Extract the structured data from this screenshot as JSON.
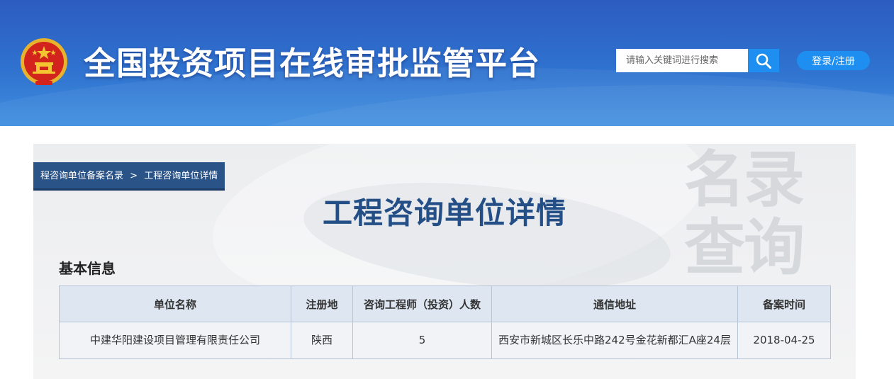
{
  "header": {
    "title": "全国投资项目在线审批监管平台",
    "search_placeholder": "请输入关键词进行搜索",
    "login_label": "登录/注册",
    "colors": {
      "header_top": "#2d5cc0",
      "header_bottom": "#3f8fe0",
      "button": "#1e8ff0"
    },
    "icons": {
      "emblem": "national-emblem-icon",
      "search": "search-icon"
    }
  },
  "breadcrumb": {
    "parent": "程咨询单位备案名录",
    "separator": ">",
    "current": "工程咨询单位详情"
  },
  "page": {
    "heading": "工程咨询单位详情",
    "watermark_line1": "名录",
    "watermark_line2": "查询",
    "accent_color": "#244f86"
  },
  "basic_info": {
    "section_title": "基本信息",
    "columns": [
      "单位名称",
      "注册地",
      "咨询工程师（投资）人数",
      "通信地址",
      "备案时间"
    ],
    "rows": [
      [
        "中建华阳建设项目管理有限责任公司",
        "陕西",
        "5",
        "西安市新城区长乐中路242号金花新都汇A座24层",
        "2018-04-25"
      ]
    ]
  }
}
